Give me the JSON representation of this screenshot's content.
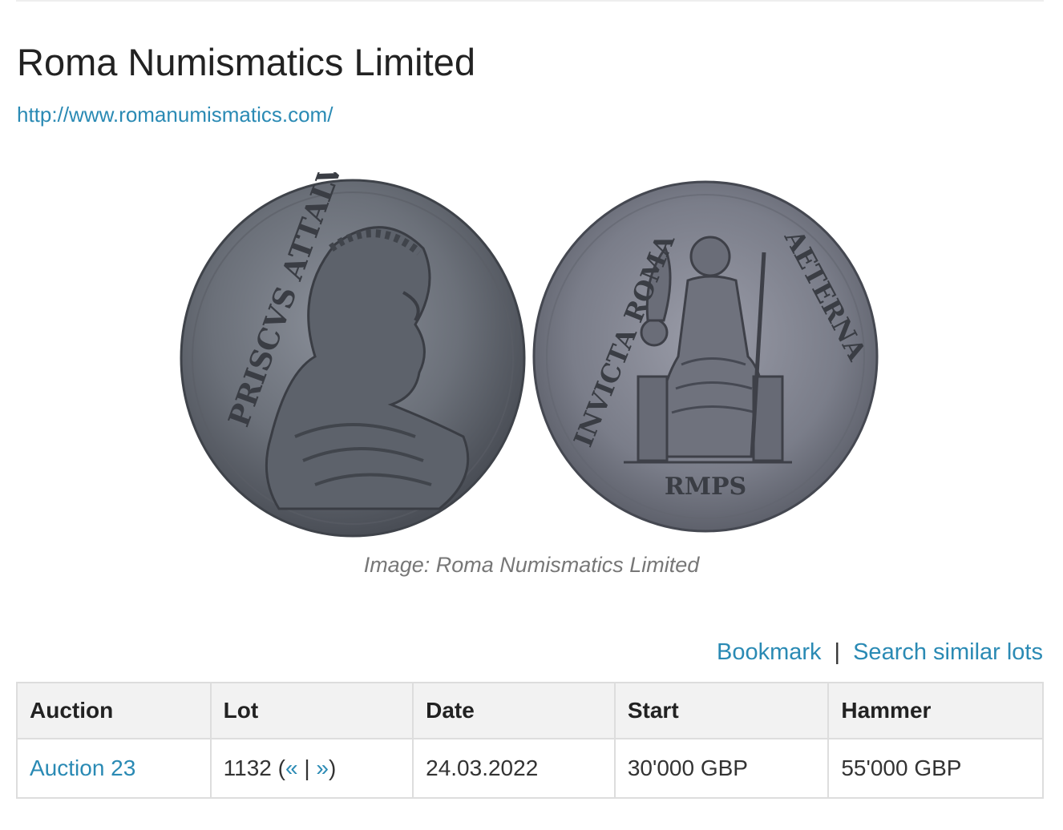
{
  "header": {
    "title": "Roma Numismatics Limited",
    "url": "http://www.romanumismatics.com/"
  },
  "image": {
    "caption": "Image: Roma Numismatics Limited",
    "obverse_legend": "PRISCVS ATTALVS",
    "reverse_legend_left": "INVICTA ROMA",
    "reverse_legend_right": "AETERNA",
    "exergue": "RMPS"
  },
  "actions": {
    "bookmark": "Bookmark",
    "separator": "|",
    "search_similar": "Search similar lots"
  },
  "table": {
    "headers": {
      "auction": "Auction",
      "lot": "Lot",
      "date": "Date",
      "start": "Start",
      "hammer": "Hammer"
    },
    "row": {
      "auction": "Auction 23",
      "lot_number": "1132",
      "lot_open": " (",
      "prev": "«",
      "lot_sep": " | ",
      "next": "»",
      "lot_close": ")",
      "date": "24.03.2022",
      "start": "30'000 GBP",
      "hammer": "55'000 GBP"
    }
  },
  "colors": {
    "link": "#2a8ab4",
    "header_bg": "#f2f2f2",
    "border": "#dddddd"
  }
}
